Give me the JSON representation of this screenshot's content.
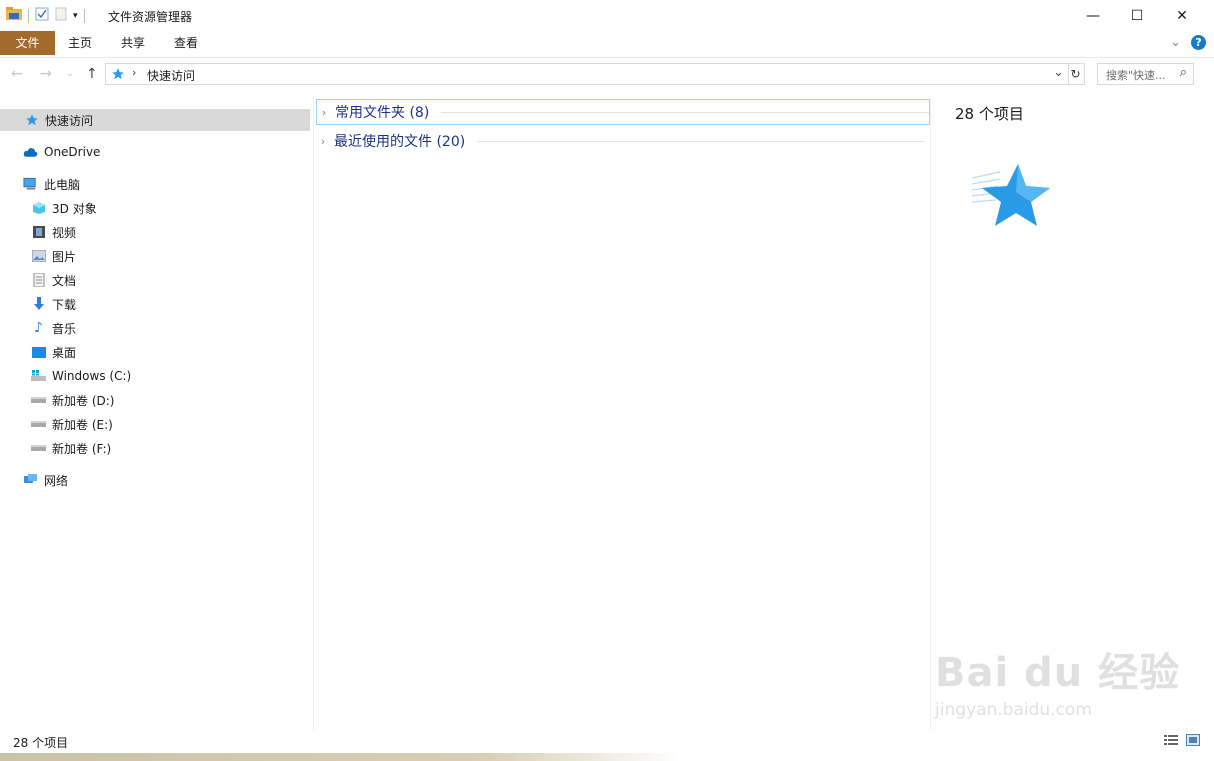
{
  "window": {
    "title": "文件资源管理器",
    "minimize": "—",
    "maximize": "☐",
    "close": "✕"
  },
  "ribbon": {
    "tabs": [
      "文件",
      "主页",
      "共享",
      "查看"
    ],
    "expand": "⌄",
    "help": "?"
  },
  "nav": {
    "back": "←",
    "forward": "→",
    "recent": "⌄",
    "up": "↑",
    "crumb_sep": "›",
    "breadcrumb": "快速访问",
    "dropdown": "⌄",
    "refresh": "↻",
    "search_placeholder": "搜索\"快速...",
    "search_icon": "⌕"
  },
  "navpane": {
    "quick_access": "快速访问",
    "onedrive": "OneDrive",
    "this_pc": "此电脑",
    "pc_items": [
      "3D 对象",
      "视频",
      "图片",
      "文档",
      "下载",
      "音乐",
      "桌面",
      "Windows (C:)",
      "新加卷 (D:)",
      "新加卷 (E:)",
      "新加卷 (F:)"
    ],
    "network": "网络"
  },
  "content": {
    "groups": [
      {
        "label": "常用文件夹 (8)",
        "expanded": false
      },
      {
        "label": "最近使用的文件 (20)",
        "expanded": false
      }
    ],
    "chevron": "›"
  },
  "preview": {
    "count": "28 个项目"
  },
  "status": {
    "text": "28 个项目"
  },
  "watermark": {
    "brand": "Bai  du 经验",
    "url": "jingyan.baidu.com"
  },
  "colors": {
    "file_tab": "#a36b2b",
    "accent": "#1979ca",
    "group_text": "#1e3287",
    "selection": "#d9d9d9"
  }
}
